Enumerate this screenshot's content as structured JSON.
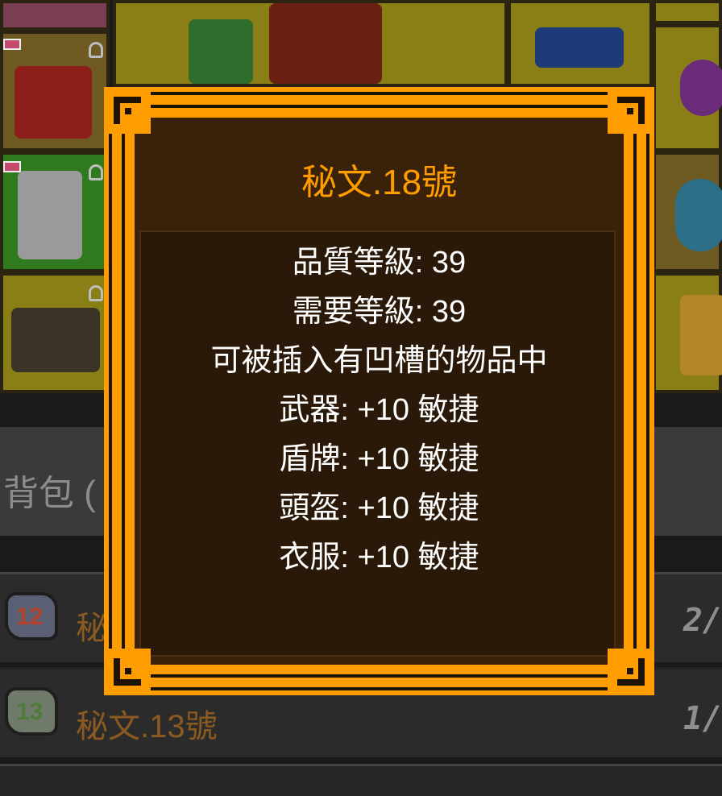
{
  "tooltip": {
    "title": "秘文.18號",
    "lines": [
      "品質等級: 39",
      "需要等級: 39",
      "可被插入有凹槽的物品中",
      "武器: +10 敏捷",
      "盾牌: +10 敏捷",
      "頭盔: +10 敏捷",
      "衣服: +10 敏捷"
    ]
  },
  "inventory": {
    "bag_label": "背包 (",
    "rows": [
      {
        "icon": "rune-12-icon",
        "number": "12",
        "name": "秘",
        "count": "2/"
      },
      {
        "icon": "rune-13-icon",
        "number": "13",
        "name": "秘文.13號",
        "count": "1/"
      }
    ]
  },
  "colors": {
    "tooltip_border": "#ff9c00",
    "tooltip_background": "#3a2109",
    "title": "#ff9c00",
    "text": "#ffffff",
    "rune_name_dim": "#8b5a20"
  }
}
